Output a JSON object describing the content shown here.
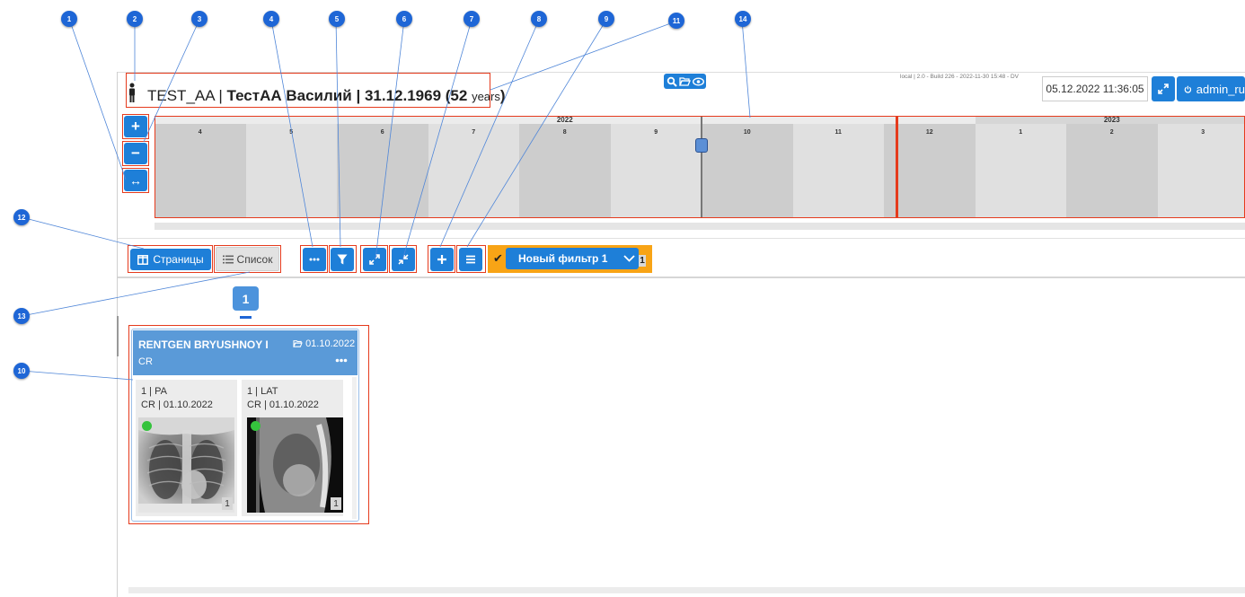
{
  "annotations": [
    "1",
    "2",
    "3",
    "4",
    "5",
    "6",
    "7",
    "8",
    "9",
    "11",
    "14",
    "12",
    "13",
    "10"
  ],
  "header": {
    "patient_id": "TEST_AA",
    "separator": "|",
    "patient_name": "ТестАА Василий",
    "birth_date": "31.12.1969",
    "age_open": "(52",
    "age_unit": "years",
    "age_close": ")",
    "build_info": "local | 2.0 - Build 226 - 2022-11-30 15:48 - DV",
    "datetime": "05.12.2022 11:36:05",
    "user": "admin_ru",
    "tool_icons": [
      "search-icon",
      "folder-open-icon",
      "eye-icon"
    ]
  },
  "zoom": {
    "in": "+",
    "out": "−",
    "fit": "↔"
  },
  "timeline": {
    "years": [
      "2022",
      "2023"
    ],
    "months": [
      "4",
      "5",
      "6",
      "7",
      "8",
      "9",
      "10",
      "11",
      "12",
      "1",
      "2",
      "3"
    ]
  },
  "toolbar": {
    "pages_label": "Страницы",
    "list_label": "Список",
    "filter_name": "Новый фильтр 1",
    "filter_count": "1"
  },
  "pages": {
    "current": "1"
  },
  "study": {
    "title": "RENTGEN BRYUSHNOY I",
    "date": "01.10.2022",
    "modality": "CR",
    "series": [
      {
        "line1": "1 | PA",
        "line2": "CR | 01.10.2022",
        "count": "1"
      },
      {
        "line1": "1 | LAT",
        "line2": "CR | 01.10.2022",
        "count": "1"
      }
    ]
  },
  "colors": {
    "accent": "#1e7fd8",
    "filter": "#f8a416",
    "highlight": "#e53b1d",
    "callout": "#1e66d6"
  }
}
